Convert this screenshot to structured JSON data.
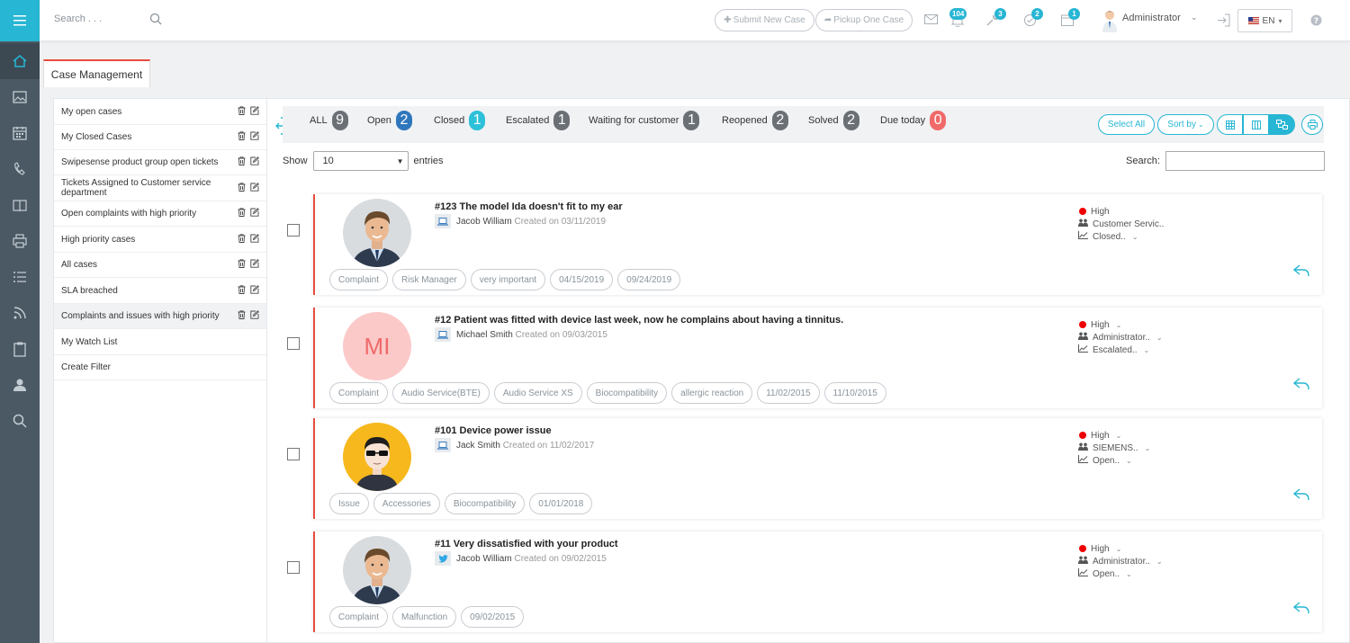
{
  "topbar": {
    "search_placeholder": "Search . . .",
    "submit_new_case": "Submit New Case",
    "pickup_one_case": "Pickup One Case",
    "badges": {
      "notifications": "104",
      "tools": "3",
      "check": "2",
      "calendar": "1"
    },
    "user_name": "Administrator",
    "language": "EN"
  },
  "tab": {
    "label": "Case Management"
  },
  "filters": [
    {
      "label": "My open cases",
      "actions": true
    },
    {
      "label": "My Closed Cases",
      "actions": true
    },
    {
      "label": "Swipesense product group open tickets",
      "actions": true
    },
    {
      "label": "Tickets Assigned to Customer service department",
      "actions": true
    },
    {
      "label": "Open complaints with high priority",
      "actions": true
    },
    {
      "label": "High priority cases",
      "actions": true
    },
    {
      "label": "All cases",
      "actions": true
    },
    {
      "label": "SLA breached",
      "actions": true
    },
    {
      "label": "Complaints and issues with high priority",
      "actions": true
    },
    {
      "label": "My Watch List",
      "actions": false
    },
    {
      "label": "Create Filter",
      "actions": false
    }
  ],
  "status_filters": [
    {
      "label": "ALL",
      "count": "9",
      "color": "gray"
    },
    {
      "label": "Open",
      "count": "2",
      "color": "blue"
    },
    {
      "label": "Closed",
      "count": "1",
      "color": "cyan"
    },
    {
      "label": "Escalated",
      "count": "1",
      "color": "gray"
    },
    {
      "label": "Waiting for customer",
      "count": "1",
      "color": "gray"
    },
    {
      "label": "Reopened",
      "count": "2",
      "color": "gray"
    },
    {
      "label": "Solved",
      "count": "2",
      "color": "gray"
    },
    {
      "label": "Due today",
      "count": "0",
      "color": "red"
    }
  ],
  "toolbar": {
    "select_all": "Select All",
    "sort_by": "Sort by"
  },
  "table": {
    "show_label": "Show",
    "entries_value": "10",
    "entries_label": "entries",
    "search_label": "Search:"
  },
  "colors": {
    "accent": "#27b6d3",
    "sidebar": "#4b5964",
    "priority_high": "#e00000",
    "card_border": "#e74c3c"
  },
  "cases": [
    {
      "title": "#123 The model Ida doesn't fit to my ear",
      "author": "Jacob William",
      "created": "Created on 03/11/2019",
      "source_icon": "laptop-icon",
      "avatar": "photo",
      "priority": "High",
      "assignee": "Customer Servic..",
      "status": "Closed..",
      "tags": [
        "Complaint",
        "Risk Manager",
        "very important",
        "04/15/2019",
        "09/24/2019"
      ]
    },
    {
      "title": "#12 Patient was fitted with device last week, now he complains about having a tinnitus.",
      "author": "Michael Smith",
      "created": "Created on 09/03/2015",
      "source_icon": "laptop-icon",
      "avatar": "initials",
      "initials": "MI",
      "priority": "High",
      "assignee": "Administrator..",
      "status": "Escalated..",
      "tags": [
        "Complaint",
        "Audio Service(BTE)",
        "Audio Service XS",
        "Biocompatibility",
        "allergic reaction",
        "11/02/2015",
        "11/10/2015"
      ]
    },
    {
      "title": "#101 Device power issue",
      "author": "Jack Smith",
      "created": "Created on 11/02/2017",
      "source_icon": "laptop-icon",
      "avatar": "cartoon",
      "priority": "High",
      "assignee": "SIEMENS..",
      "status": "Open..",
      "tags": [
        "Issue",
        "Accessories",
        "Biocompatibility",
        "01/01/2018"
      ]
    },
    {
      "title": "#11 Very dissatisfied with your product",
      "author": "Jacob William",
      "created": "Created on 09/02/2015",
      "source_icon": "twitter-icon",
      "avatar": "photo",
      "priority": "High",
      "assignee": "Administrator..",
      "status": "Open..",
      "tags": [
        "Complaint",
        "Malfunction",
        "09/02/2015"
      ]
    }
  ]
}
